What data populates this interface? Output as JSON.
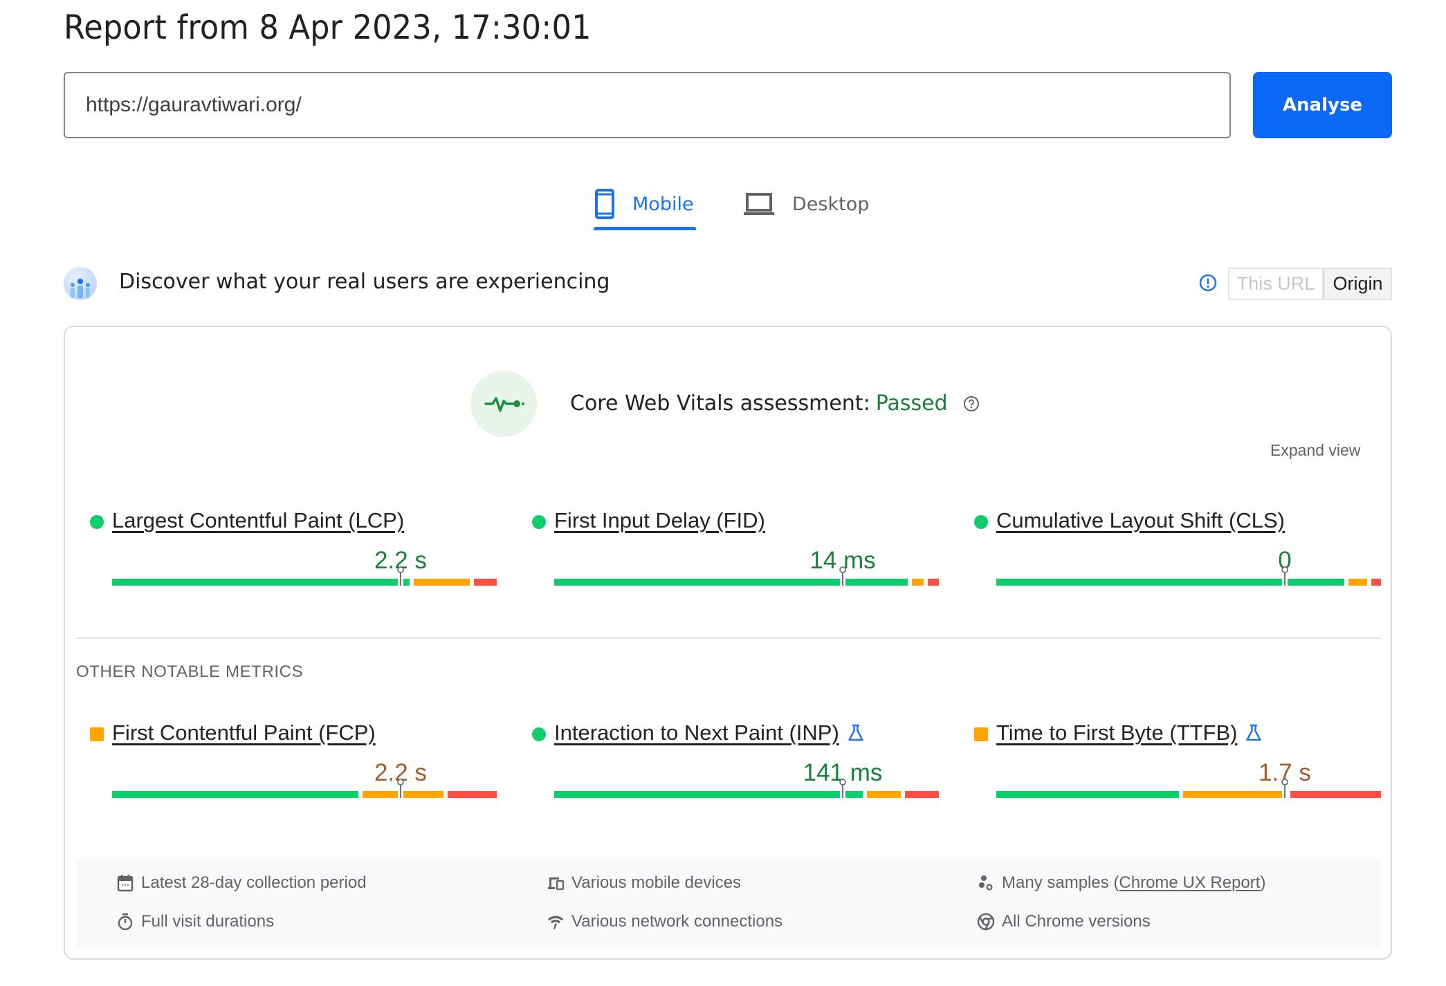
{
  "header": {
    "report_title": "Report from 8 Apr 2023, 17:30:01"
  },
  "search": {
    "url_value": "https://gauravtiwari.org/",
    "analyse_label": "Analyse"
  },
  "tabs": [
    {
      "label": "Mobile",
      "icon": "smartphone-icon",
      "active": true
    },
    {
      "label": "Desktop",
      "icon": "laptop-icon",
      "active": false
    }
  ],
  "crux": {
    "title": "Discover what your real users are experiencing",
    "toggle": {
      "this_url": "This URL",
      "origin": "Origin",
      "selected": "Origin"
    }
  },
  "assessment": {
    "label": "Core Web Vitals assessment:",
    "status": "Passed",
    "expand_label": "Expand view"
  },
  "colors": {
    "good": "#0cce6b",
    "needs_improvement": "#ffa400",
    "poor": "#ff4e42",
    "accent": "#1a73e8",
    "button": "#0b69f7",
    "passed_text": "#188038"
  },
  "core_metrics": [
    {
      "label": "Largest Contentful Paint (LCP)",
      "value": "2.2 s",
      "rating": "good",
      "experimental": false,
      "distribution": {
        "good": 0.79,
        "needs_improvement": 0.15,
        "poor": 0.06
      },
      "p75_position": 0.75
    },
    {
      "label": "First Input Delay (FID)",
      "value": "14 ms",
      "rating": "good",
      "experimental": false,
      "distribution": {
        "good": 0.94,
        "needs_improvement": 0.03,
        "poor": 0.03
      },
      "p75_position": 0.75
    },
    {
      "label": "Cumulative Layout Shift (CLS)",
      "value": "0",
      "rating": "good",
      "experimental": false,
      "distribution": {
        "good": 0.924,
        "needs_improvement": 0.05,
        "poor": 0.026
      },
      "p75_position": 0.75
    }
  ],
  "other_heading": "OTHER NOTABLE METRICS",
  "other_metrics": [
    {
      "label": "First Contentful Paint (FCP)",
      "value": "2.2 s",
      "rating": "needs_improvement",
      "experimental": false,
      "distribution": {
        "good": 0.655,
        "needs_improvement": 0.215,
        "poor": 0.13
      },
      "p75_position": 0.75
    },
    {
      "label": "Interaction to Next Paint (INP)",
      "value": "141 ms",
      "rating": "good",
      "experimental": true,
      "distribution": {
        "good": 0.82,
        "needs_improvement": 0.09,
        "poor": 0.09
      },
      "p75_position": 0.75
    },
    {
      "label": "Time to First Byte (TTFB)",
      "value": "1.7 s",
      "rating": "needs_improvement",
      "experimental": true,
      "distribution": {
        "good": 0.485,
        "needs_improvement": 0.275,
        "poor": 0.24
      },
      "p75_position": 0.75
    }
  ],
  "info": {
    "collection_period": "Latest 28-day collection period",
    "devices": "Various mobile devices",
    "samples_prefix": "Many samples (",
    "samples_link": "Chrome UX Report",
    "samples_suffix": ")",
    "durations": "Full visit durations",
    "network": "Various network connections",
    "chrome_versions": "All Chrome versions"
  }
}
